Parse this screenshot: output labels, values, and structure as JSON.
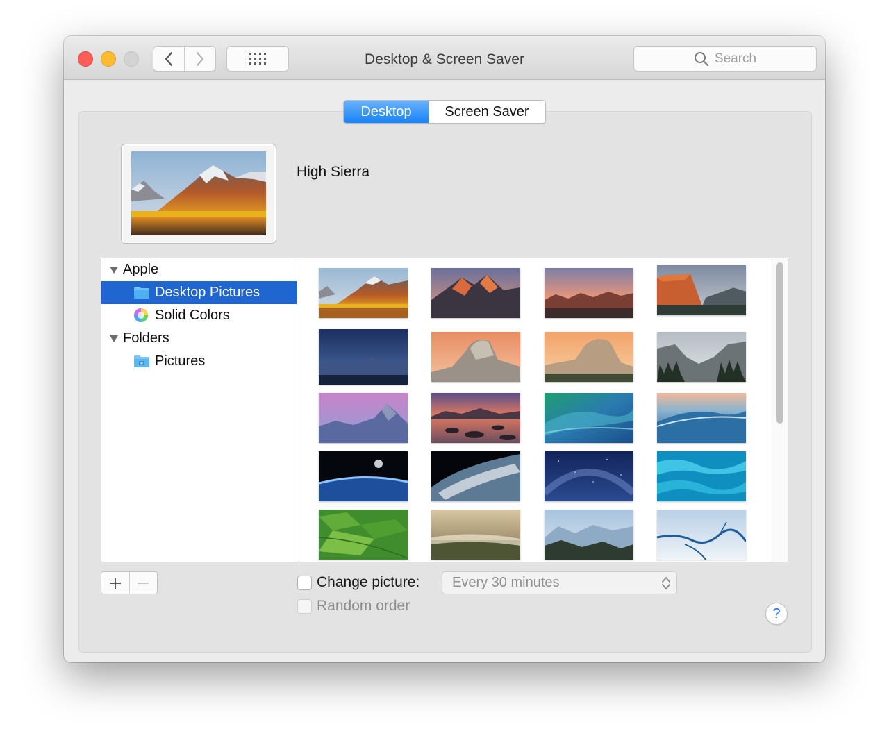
{
  "window": {
    "title": "Desktop & Screen Saver"
  },
  "toolbar": {
    "back_icon": "chevron-left-icon",
    "forward_icon": "chevron-right-icon",
    "show_all_icon": "grid-icon"
  },
  "search": {
    "placeholder": "Search",
    "icon": "search-icon"
  },
  "tabs": [
    {
      "label": "Desktop",
      "selected": true
    },
    {
      "label": "Screen Saver",
      "selected": false
    }
  ],
  "preview": {
    "name": "High Sierra"
  },
  "source_list": [
    {
      "label": "Apple",
      "type": "group",
      "expanded": true
    },
    {
      "label": "Desktop Pictures",
      "type": "item",
      "icon": "folder-icon",
      "selected": true
    },
    {
      "label": "Solid Colors",
      "type": "item",
      "icon": "color-wheel-icon",
      "selected": false
    },
    {
      "label": "Folders",
      "type": "group",
      "expanded": true
    },
    {
      "label": "Pictures",
      "type": "item",
      "icon": "pictures-folder-icon",
      "selected": false
    }
  ],
  "thumbnails": [
    {
      "name": "high-sierra-thumb",
      "selected": true
    },
    {
      "name": "sierra-thumb"
    },
    {
      "name": "sierra-2-thumb"
    },
    {
      "name": "el-capitan-thumb"
    },
    {
      "name": "yosemite-night-thumb"
    },
    {
      "name": "yosemite-half-dome-thumb"
    },
    {
      "name": "yosemite-el-capitan-thumb"
    },
    {
      "name": "yosemite-valley-thumb"
    },
    {
      "name": "yosemite-pink-thumb"
    },
    {
      "name": "lake-rocks-thumb"
    },
    {
      "name": "green-wave-thumb"
    },
    {
      "name": "blue-wave-thumb"
    },
    {
      "name": "earth-horizon-thumb"
    },
    {
      "name": "earth-clouds-thumb"
    },
    {
      "name": "milky-way-thumb"
    },
    {
      "name": "turquoise-water-thumb"
    },
    {
      "name": "green-fields-thumb"
    },
    {
      "name": "misty-forest-thumb"
    },
    {
      "name": "blue-mountains-thumb"
    },
    {
      "name": "ice-floe-thumb"
    }
  ],
  "bottom": {
    "add_icon": "plus-icon",
    "remove_icon": "minus-icon",
    "change_picture_label": "Change picture:",
    "change_picture_checked": false,
    "interval": "Every 30 minutes",
    "random_order_label": "Random order",
    "random_order_checked": false,
    "help_label": "?"
  }
}
